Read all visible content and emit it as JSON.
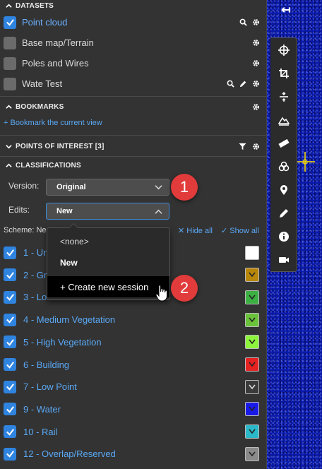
{
  "datasets": {
    "header": "DATASETS",
    "items": [
      {
        "label": "Point cloud",
        "checked": true
      },
      {
        "label": "Base map/Terrain",
        "checked": false
      },
      {
        "label": "Poles and Wires",
        "checked": false
      },
      {
        "label": "Wate Test",
        "checked": false
      }
    ]
  },
  "bookmarks": {
    "header": "BOOKMARKS",
    "add_link": "+ Bookmark the current view"
  },
  "poi": {
    "header": "POINTS OF INTEREST [3]"
  },
  "classifications": {
    "header": "CLASSIFICATIONS",
    "version_label": "Version:",
    "version_value": "Original",
    "edits_label": "Edits:",
    "edits_value": "New",
    "scheme_label": "Scheme: Ne",
    "hide_all": "✕ Hide all",
    "show_all": "✓ Show all",
    "items": [
      {
        "label": "1 - Un",
        "color": "#ffffff"
      },
      {
        "label": "2 - Gro",
        "color": "#b8860b"
      },
      {
        "label": "3 - Lo",
        "color": "#3cb043"
      },
      {
        "label": "4 - Medium Vegetation",
        "color": "#6ac23a"
      },
      {
        "label": "5 - High Vegetation",
        "color": "#8cf53c"
      },
      {
        "label": "6 - Building",
        "color": "#e52222"
      },
      {
        "label": "7 - Low Point",
        "color": "#3a3a3a"
      },
      {
        "label": "9 - Water",
        "color": "#1a1ae8"
      },
      {
        "label": "10 - Rail",
        "color": "#2bb8c8"
      },
      {
        "label": "12 - Overlap/Reserved",
        "color": "#8a8a8a"
      }
    ]
  },
  "dropdown": {
    "options": [
      {
        "label": "<none>"
      },
      {
        "label": "New"
      },
      {
        "label": "+ Create new session"
      }
    ]
  },
  "callouts": [
    "1",
    "2"
  ],
  "toolbar": {
    "collapse_glyph": "↤",
    "tools": [
      "target-icon",
      "crop-icon",
      "split-icon",
      "terrain-icon",
      "ruler-icon",
      "layers-icon",
      "location-pin-icon",
      "pencil-icon",
      "info-icon",
      "video-camera-icon"
    ]
  },
  "colors": {
    "accent": "#2f84e0",
    "link": "#5aa8f5",
    "panel": "#333333",
    "callout": "#e23b3b"
  }
}
